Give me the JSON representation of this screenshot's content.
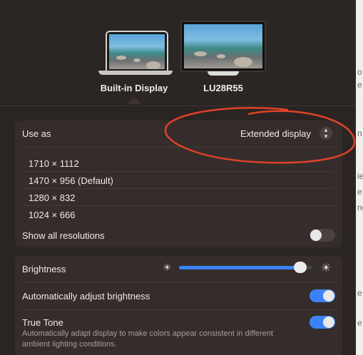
{
  "displays": [
    {
      "label": "Built-in Display",
      "selected": true
    },
    {
      "label": "LU28R55",
      "selected": false
    }
  ],
  "use_as": {
    "label": "Use as",
    "value": "Extended display"
  },
  "resolutions": [
    "1710 × 1112",
    "1470 × 956 (Default)",
    "1280 × 832",
    "1024 × 666"
  ],
  "show_all": {
    "label": "Show all resolutions",
    "on": false
  },
  "brightness": {
    "label": "Brightness",
    "level": 0.96
  },
  "auto_brightness": {
    "label": "Automatically adjust brightness",
    "on": true
  },
  "true_tone": {
    "label": "True Tone",
    "description": "Automatically adapt display to make colors appear consistent in different ambient lighting conditions.",
    "on": true
  },
  "edge_text": [
    "o",
    "e",
    "n",
    "ie",
    "e",
    "no",
    "e",
    "e"
  ],
  "colors": {
    "accent": "#3b82f6",
    "annotation": "#e0412b"
  },
  "icons": {
    "stepper": "chevron-up-down-icon",
    "sun_low": "sun-small-icon",
    "sun_high": "sun-large-icon"
  }
}
